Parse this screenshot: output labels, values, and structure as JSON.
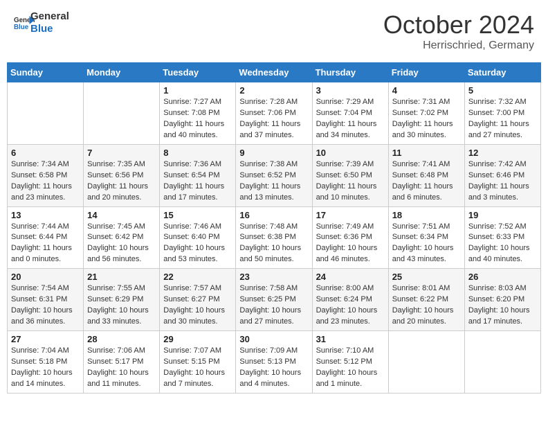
{
  "header": {
    "logo_line1": "General",
    "logo_line2": "Blue",
    "month": "October 2024",
    "location": "Herrischried, Germany"
  },
  "weekdays": [
    "Sunday",
    "Monday",
    "Tuesday",
    "Wednesday",
    "Thursday",
    "Friday",
    "Saturday"
  ],
  "weeks": [
    [
      {
        "day": "",
        "info": ""
      },
      {
        "day": "",
        "info": ""
      },
      {
        "day": "1",
        "info": "Sunrise: 7:27 AM\nSunset: 7:08 PM\nDaylight: 11 hours and 40 minutes."
      },
      {
        "day": "2",
        "info": "Sunrise: 7:28 AM\nSunset: 7:06 PM\nDaylight: 11 hours and 37 minutes."
      },
      {
        "day": "3",
        "info": "Sunrise: 7:29 AM\nSunset: 7:04 PM\nDaylight: 11 hours and 34 minutes."
      },
      {
        "day": "4",
        "info": "Sunrise: 7:31 AM\nSunset: 7:02 PM\nDaylight: 11 hours and 30 minutes."
      },
      {
        "day": "5",
        "info": "Sunrise: 7:32 AM\nSunset: 7:00 PM\nDaylight: 11 hours and 27 minutes."
      }
    ],
    [
      {
        "day": "6",
        "info": "Sunrise: 7:34 AM\nSunset: 6:58 PM\nDaylight: 11 hours and 23 minutes."
      },
      {
        "day": "7",
        "info": "Sunrise: 7:35 AM\nSunset: 6:56 PM\nDaylight: 11 hours and 20 minutes."
      },
      {
        "day": "8",
        "info": "Sunrise: 7:36 AM\nSunset: 6:54 PM\nDaylight: 11 hours and 17 minutes."
      },
      {
        "day": "9",
        "info": "Sunrise: 7:38 AM\nSunset: 6:52 PM\nDaylight: 11 hours and 13 minutes."
      },
      {
        "day": "10",
        "info": "Sunrise: 7:39 AM\nSunset: 6:50 PM\nDaylight: 11 hours and 10 minutes."
      },
      {
        "day": "11",
        "info": "Sunrise: 7:41 AM\nSunset: 6:48 PM\nDaylight: 11 hours and 6 minutes."
      },
      {
        "day": "12",
        "info": "Sunrise: 7:42 AM\nSunset: 6:46 PM\nDaylight: 11 hours and 3 minutes."
      }
    ],
    [
      {
        "day": "13",
        "info": "Sunrise: 7:44 AM\nSunset: 6:44 PM\nDaylight: 11 hours and 0 minutes."
      },
      {
        "day": "14",
        "info": "Sunrise: 7:45 AM\nSunset: 6:42 PM\nDaylight: 10 hours and 56 minutes."
      },
      {
        "day": "15",
        "info": "Sunrise: 7:46 AM\nSunset: 6:40 PM\nDaylight: 10 hours and 53 minutes."
      },
      {
        "day": "16",
        "info": "Sunrise: 7:48 AM\nSunset: 6:38 PM\nDaylight: 10 hours and 50 minutes."
      },
      {
        "day": "17",
        "info": "Sunrise: 7:49 AM\nSunset: 6:36 PM\nDaylight: 10 hours and 46 minutes."
      },
      {
        "day": "18",
        "info": "Sunrise: 7:51 AM\nSunset: 6:34 PM\nDaylight: 10 hours and 43 minutes."
      },
      {
        "day": "19",
        "info": "Sunrise: 7:52 AM\nSunset: 6:33 PM\nDaylight: 10 hours and 40 minutes."
      }
    ],
    [
      {
        "day": "20",
        "info": "Sunrise: 7:54 AM\nSunset: 6:31 PM\nDaylight: 10 hours and 36 minutes."
      },
      {
        "day": "21",
        "info": "Sunrise: 7:55 AM\nSunset: 6:29 PM\nDaylight: 10 hours and 33 minutes."
      },
      {
        "day": "22",
        "info": "Sunrise: 7:57 AM\nSunset: 6:27 PM\nDaylight: 10 hours and 30 minutes."
      },
      {
        "day": "23",
        "info": "Sunrise: 7:58 AM\nSunset: 6:25 PM\nDaylight: 10 hours and 27 minutes."
      },
      {
        "day": "24",
        "info": "Sunrise: 8:00 AM\nSunset: 6:24 PM\nDaylight: 10 hours and 23 minutes."
      },
      {
        "day": "25",
        "info": "Sunrise: 8:01 AM\nSunset: 6:22 PM\nDaylight: 10 hours and 20 minutes."
      },
      {
        "day": "26",
        "info": "Sunrise: 8:03 AM\nSunset: 6:20 PM\nDaylight: 10 hours and 17 minutes."
      }
    ],
    [
      {
        "day": "27",
        "info": "Sunrise: 7:04 AM\nSunset: 5:18 PM\nDaylight: 10 hours and 14 minutes."
      },
      {
        "day": "28",
        "info": "Sunrise: 7:06 AM\nSunset: 5:17 PM\nDaylight: 10 hours and 11 minutes."
      },
      {
        "day": "29",
        "info": "Sunrise: 7:07 AM\nSunset: 5:15 PM\nDaylight: 10 hours and 7 minutes."
      },
      {
        "day": "30",
        "info": "Sunrise: 7:09 AM\nSunset: 5:13 PM\nDaylight: 10 hours and 4 minutes."
      },
      {
        "day": "31",
        "info": "Sunrise: 7:10 AM\nSunset: 5:12 PM\nDaylight: 10 hours and 1 minute."
      },
      {
        "day": "",
        "info": ""
      },
      {
        "day": "",
        "info": ""
      }
    ]
  ]
}
